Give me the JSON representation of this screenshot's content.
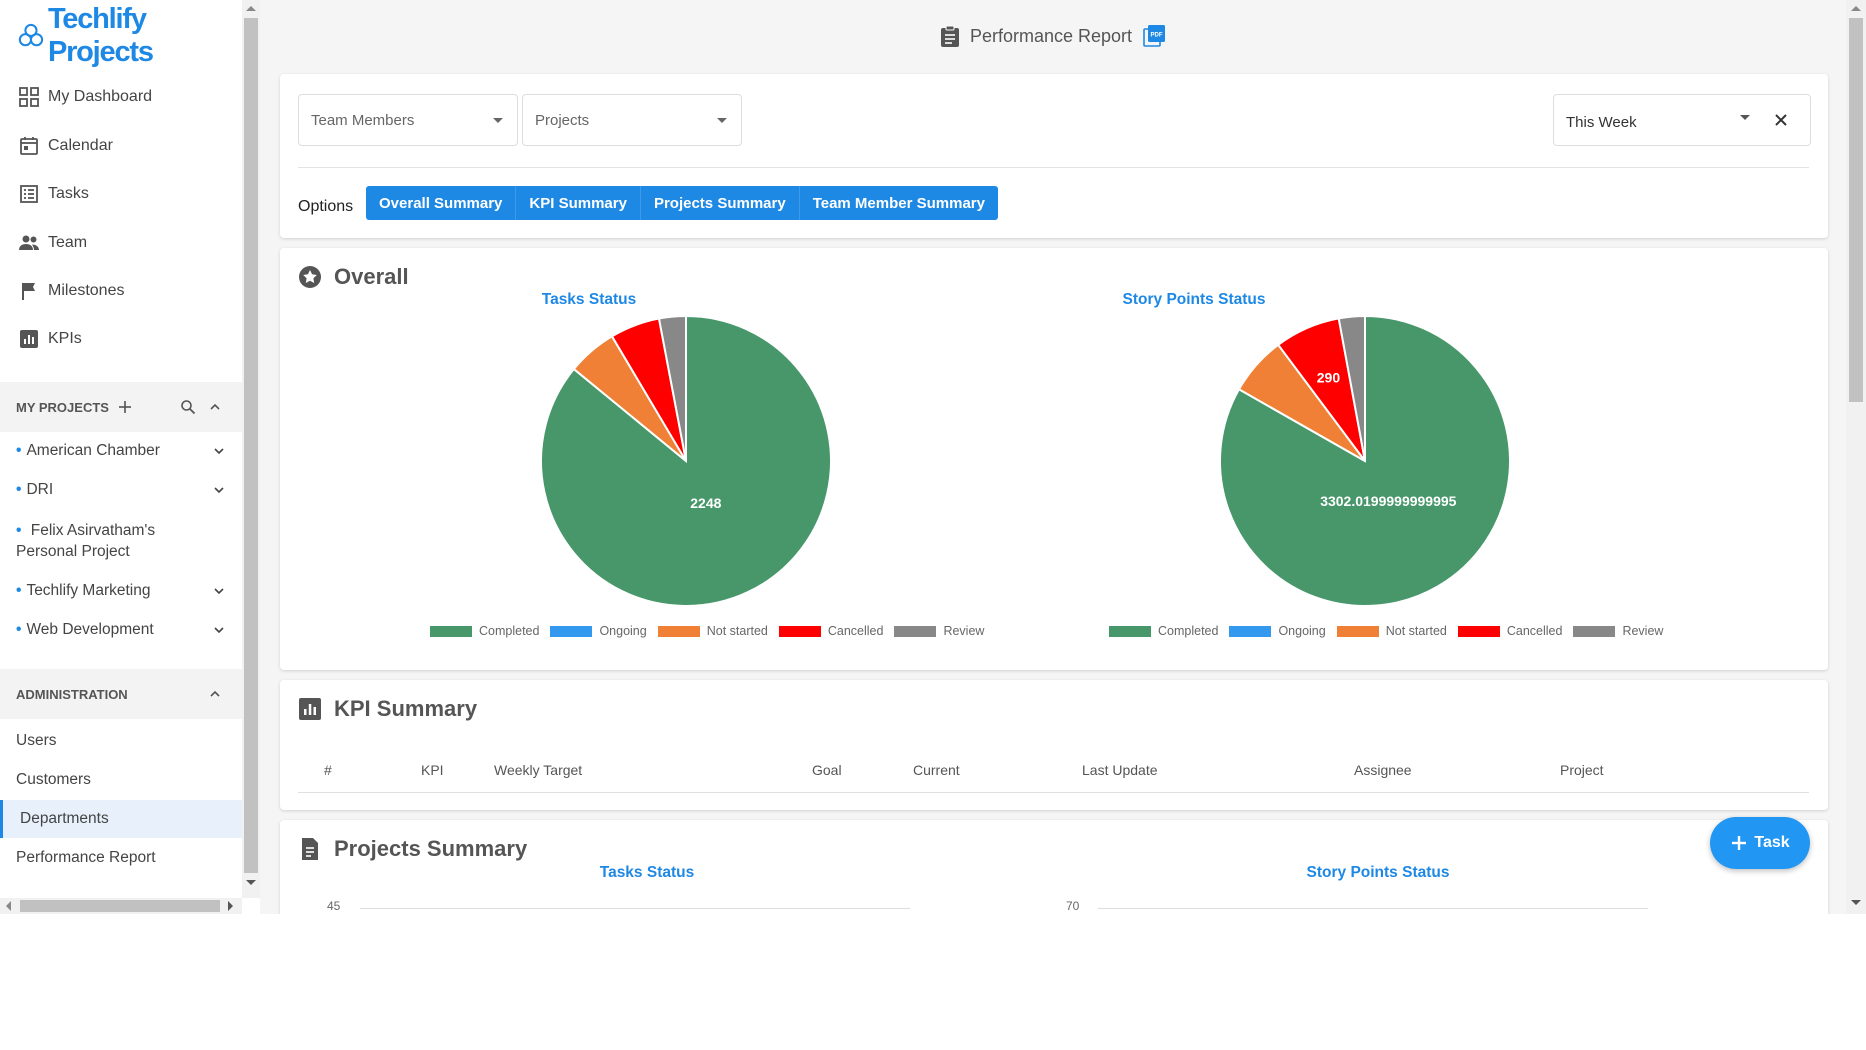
{
  "app": {
    "logo_text": "Techlify Projects"
  },
  "sidebar": {
    "nav": [
      {
        "label": "My Dashboard",
        "icon": "dashboard-icon"
      },
      {
        "label": "Calendar",
        "icon": "calendar-icon"
      },
      {
        "label": "Tasks",
        "icon": "tasks-icon"
      },
      {
        "label": "Team",
        "icon": "team-icon"
      },
      {
        "label": "Milestones",
        "icon": "flag-icon"
      },
      {
        "label": "KPIs",
        "icon": "kpi-icon"
      }
    ],
    "my_projects": {
      "heading": "MY PROJECTS",
      "items": [
        {
          "label": "American Chamber"
        },
        {
          "label": "DRI"
        },
        {
          "label": "Felix Asirvatham's Personal Project"
        },
        {
          "label": "Techlify Marketing"
        },
        {
          "label": "Web Development"
        }
      ]
    },
    "administration": {
      "heading": "ADMINISTRATION",
      "items": [
        {
          "label": "Users"
        },
        {
          "label": "Customers"
        },
        {
          "label": "Departments",
          "active": true
        },
        {
          "label": "Performance Report"
        }
      ]
    }
  },
  "page": {
    "title": "Performance Report"
  },
  "filters": {
    "team_members": "Team Members",
    "projects": "Projects",
    "period": "This Week",
    "options_label": "Options",
    "options": [
      "Overall Summary",
      "KPI Summary",
      "Projects Summary",
      "Team Member Summary"
    ]
  },
  "overall": {
    "title": "Overall",
    "legend": [
      {
        "label": "Completed",
        "color": "#47976b"
      },
      {
        "label": "Ongoing",
        "color": "#3399ee"
      },
      {
        "label": "Not started",
        "color": "#f08035"
      },
      {
        "label": "Cancelled",
        "color": "#ff0000"
      },
      {
        "label": "Review",
        "color": "#888888"
      }
    ]
  },
  "chart_data": [
    {
      "type": "pie",
      "title": "Tasks Status",
      "categories": [
        "Completed",
        "Ongoing",
        "Not started",
        "Cancelled",
        "Review"
      ],
      "values": [
        2248,
        0,
        145,
        145,
        78
      ],
      "data_labels": [
        "2248",
        "",
        "",
        "",
        ""
      ]
    },
    {
      "type": "pie",
      "title": "Story Points Status",
      "categories": [
        "Completed",
        "Ongoing",
        "Not started",
        "Cancelled",
        "Review"
      ],
      "values": [
        3302.0199999999995,
        0,
        260,
        290,
        115
      ],
      "data_labels": [
        "3302.0199999999995",
        "",
        "",
        "290",
        ""
      ]
    },
    {
      "type": "bar",
      "title": "Tasks Status",
      "y_tick_top": "45"
    },
    {
      "type": "bar",
      "title": "Story Points Status",
      "y_tick_top": "70"
    }
  ],
  "kpi_summary": {
    "title": "KPI Summary",
    "columns": [
      "#",
      "KPI",
      "Weekly Target",
      "Goal",
      "Current",
      "Last Update",
      "Assignee",
      "Project"
    ]
  },
  "projects_summary": {
    "title": "Projects Summary"
  },
  "fab": {
    "label": "Task"
  }
}
